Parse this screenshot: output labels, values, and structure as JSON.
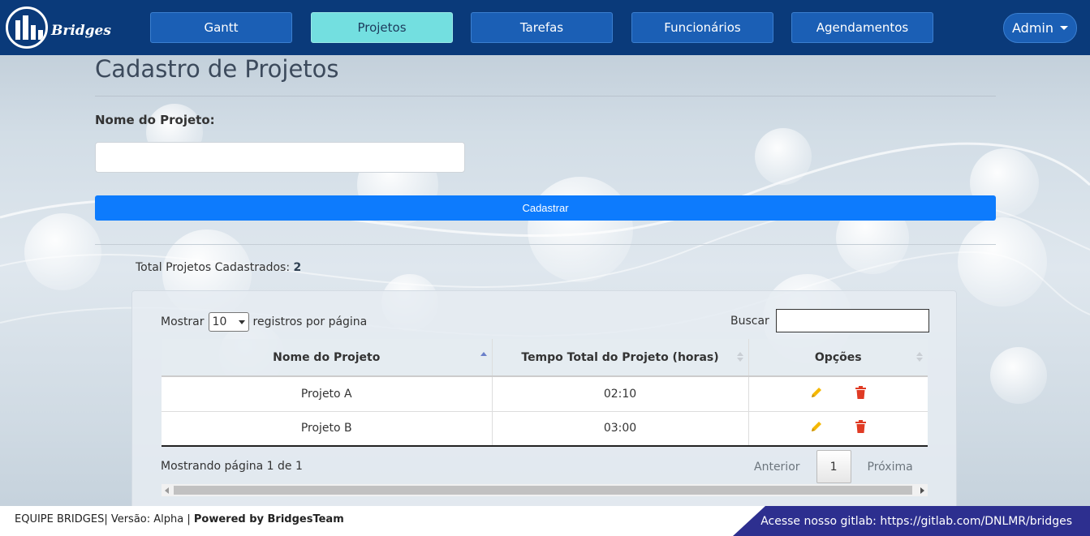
{
  "brand": {
    "name": "Bridges"
  },
  "nav": {
    "items": [
      {
        "label": "Gantt",
        "active": false
      },
      {
        "label": "Projetos",
        "active": true
      },
      {
        "label": "Tarefas",
        "active": false
      },
      {
        "label": "Funcionários",
        "active": false
      },
      {
        "label": "Agendamentos",
        "active": false
      }
    ],
    "user_menu": "Admin"
  },
  "page": {
    "title": "Cadastro de Projetos",
    "field_label": "Nome do Projeto:",
    "field_value": "",
    "submit_label": "Cadastrar",
    "total_label": "Total Projetos Cadastrados:",
    "total_value": "2"
  },
  "table": {
    "length_prefix": "Mostrar",
    "length_value": "10",
    "length_suffix": "registros por página",
    "search_label": "Buscar",
    "search_value": "",
    "columns": [
      "Nome do Projeto",
      "Tempo Total do Projeto (horas)",
      "Opções"
    ],
    "rows": [
      {
        "name": "Projeto A",
        "time": "02:10"
      },
      {
        "name": "Projeto B",
        "time": "03:00"
      }
    ],
    "info": "Mostrando página 1 de 1",
    "pager": {
      "prev": "Anterior",
      "current": "1",
      "next": "Próxima"
    }
  },
  "colors": {
    "navbar": "#0a3a7a",
    "active_tab": "#73dfe0",
    "primary": "#0d7bfd",
    "edit_icon": "#f5b800",
    "delete_icon": "#e03b24",
    "footer_banner": "#2d2f8f"
  },
  "footer": {
    "left_text": "EQUIPE BRIDGES| Versão: Alpha |",
    "left_bold": "Powered by BridgesTeam",
    "right_text": "Acesse nosso gitlab: https://gitlab.com/DNLMR/bridges"
  }
}
